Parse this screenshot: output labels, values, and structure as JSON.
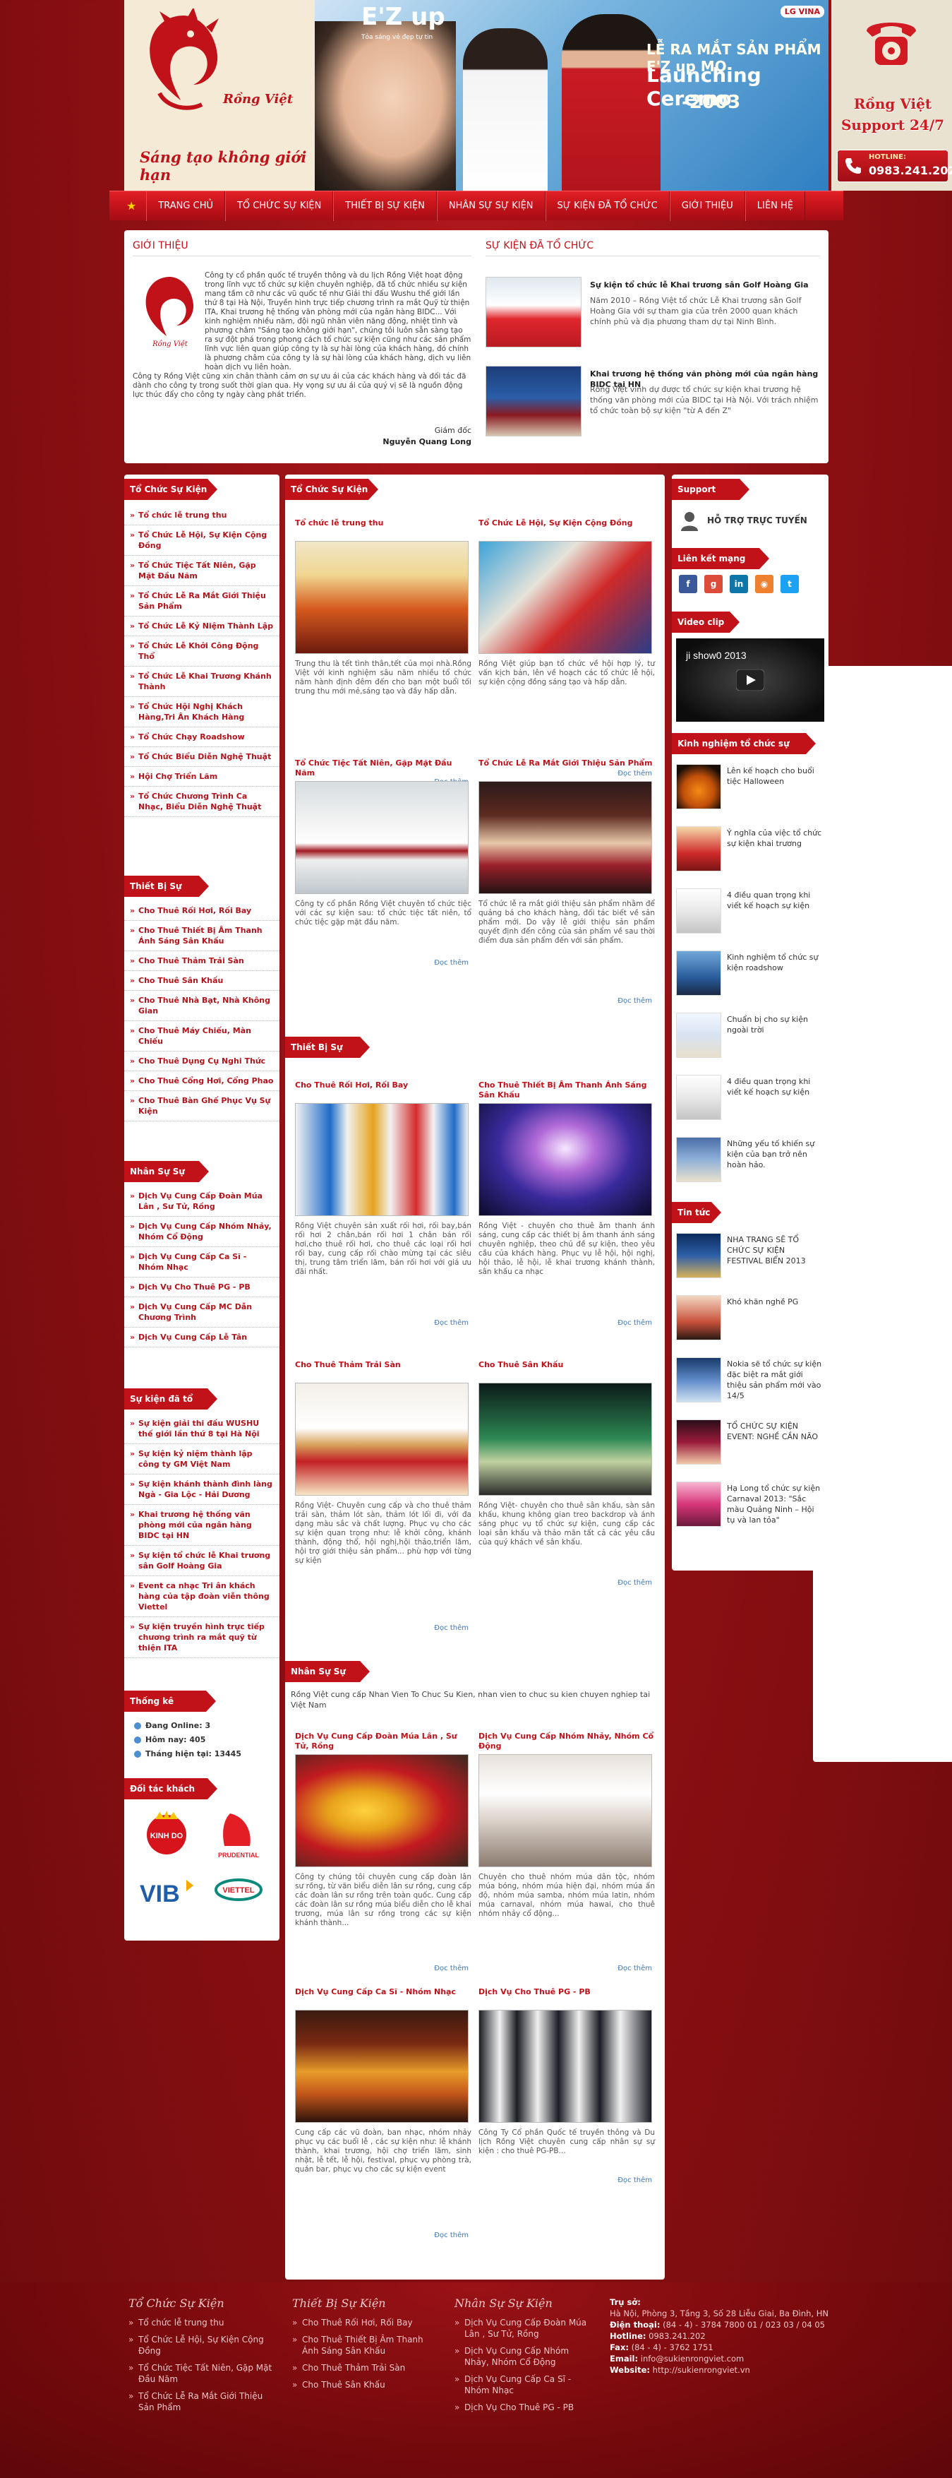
{
  "brand": {
    "name": "Rồng Việt",
    "slogan": "Sáng tạo không giới hạn"
  },
  "banner": {
    "product": "E'Z up",
    "tagline": "Tỏa sáng vẻ đẹp tự tin",
    "headline_small": "LỄ RA MẮT SẢN PHẨM E'Z up MO",
    "headline": "Launching Ceremo",
    "year": "-2003",
    "lg": "LG VINA"
  },
  "support": {
    "title": "Rồng Việt Support 24/7",
    "hotline_label": "HOTLINE:",
    "hotline_number": "0983.241.202"
  },
  "nav": {
    "items": [
      "TRANG CHỦ",
      "TỔ CHỨC SỰ KIỆN",
      "THIẾT BỊ SỰ KIỆN",
      "NHÂN SỰ SỰ KIỆN",
      "SỰ KIỆN ĐÃ TỔ CHỨC",
      "GIỚI THIỆU",
      "LIÊN HỆ"
    ]
  },
  "intro": {
    "title": "GIỚI THIỆU",
    "paragraphs": [
      "Công ty cổ phần quốc tế truyền thông và du lịch Rồng Việt hoạt động trong lĩnh vực tổ chức sự kiện chuyên nghiệp, đã tổ chức nhiều sự kiện mang tầm cỡ như các vũ quốc tế như Giải thi đấu Wushu thế giới lần thứ 8 tại Hà Nội, Truyền hình trực tiếp chương trình ra mắt Quỹ từ thiện ITA, Khai trương hệ thống văn phòng mới của ngân hàng BIDC... Với kinh nghiệm nhiều năm, đội ngũ nhân viên năng động, nhiệt tình và phương châm \"Sáng tạo không giới hạn\", chúng tôi luôn sẵn sàng tạo ra sự đột phá trong phong cách tổ chức sự kiện cũng như các sản phẩm lĩnh vực liên quan giúp công ty là sự hài lòng của khách hàng, đó chính là phương châm của công ty là sự hài lòng của khách hàng, dịch vụ liên hoàn dịch vụ liên hoàn.",
      "Công ty Rồng Việt cũng xin chân thành cảm ơn sự ưu ái của các khách hàng và đối tác đã dành cho công ty trong suốt thời gian qua. Hy vọng sự ưu ái của quý vị sẽ là nguồn động lực thúc đẩy cho công ty ngày càng phát triển."
    ],
    "sign_role": "Giám đốc",
    "sign_name": "Nguyễn Quang Long"
  },
  "organized": {
    "title": "SỰ KIỆN ĐÃ TỔ CHỨC",
    "items": [
      {
        "title": "Sự kiện tổ chức lễ Khai trương sân Golf Hoàng Gia",
        "desc": "Năm 2010 – Rồng Việt tổ chức Lễ Khai trương sân Golf Hoàng Gia với sự tham gia của trên 2000 quan khách chính phủ và địa phương tham dự tại Ninh Bình."
      },
      {
        "title": "Khai trương hệ thống văn phòng mới của ngân hàng BIDC tại HN",
        "desc": "Rồng Việt vinh dự được tổ chức sự kiện khai trương hệ thống văn phòng mới của BIDC tại Hà Nội. Với trách nhiệm tổ chức toàn bộ sự kiện \"từ A đến Z\""
      }
    ]
  },
  "left": {
    "sec1_title": "Tổ Chức Sự Kiện",
    "sec1_items": [
      "Tổ chức lễ trung thu",
      "Tổ Chức Lễ Hội, Sự Kiện Cộng Đồng",
      "Tổ Chức Tiệc Tất Niên, Gặp Mặt Đầu Năm",
      "Tổ Chức Lễ Ra Mắt Giới Thiệu Sản Phẩm",
      "Tổ Chức Lễ Kỷ Niệm Thành Lập",
      "Tổ Chức Lễ Khởi Công Động Thổ",
      "Tổ Chức Lễ Khai Trương Khánh Thành",
      "Tổ Chức Hội Nghị Khách Hàng,Tri Ân Khách Hàng",
      "Tổ Chức Chạy Roadshow",
      "Tổ Chức Biểu Diễn Nghệ Thuật",
      "Hội Chợ Triển Lãm",
      "Tổ Chức Chương Trình Ca Nhạc, Biểu Diễn Nghệ Thuật"
    ],
    "sec2_title": "Thiết Bị Sự Kiện",
    "sec2_items": [
      "Cho Thuê Rối Hơi, Rối Bay",
      "Cho Thuê Thiết Bị Âm Thanh Ánh Sáng Sân Khấu",
      "Cho Thuê Thảm Trải Sàn",
      "Cho Thuê Sân Khấu",
      "Cho Thuê Nhà Bạt, Nhà Không Gian",
      "Cho Thuê Máy Chiếu, Màn Chiếu",
      "Cho Thuê Dụng Cụ Nghi Thức",
      "Cho Thuê Cổng Hơi, Cổng Phao",
      "Cho Thuê Bàn Ghế Phục Vụ Sự Kiện"
    ],
    "sec3_title": "Nhân Sự Sự Kiện",
    "sec3_items": [
      "Dịch Vụ Cung Cấp Đoàn Múa Lân , Sư Tử, Rồng",
      "Dịch Vụ Cung Cấp Nhóm Nhảy, Nhóm Cổ Động",
      "Dịch Vụ Cung Cấp Ca Sĩ - Nhóm Nhạc",
      "Dịch Vụ Cho Thuê PG - PB",
      "Dịch Vụ Cung Cấp MC Dẫn Chương Trình",
      "Dịch Vụ Cung Cấp Lễ Tân"
    ],
    "sec4_title": "Sự kiện đã tổ chức",
    "sec4_items": [
      "Sự kiện giải thi đấu WUSHU thế giới lần thứ 8 tại Hà Nội",
      "Sự kiện kỷ niệm thành lập công ty GM Việt Nam",
      "Sự kiện khánh thành đình làng Ngà - Gia Lộc - Hải Dương",
      "Khai trương hệ thống văn phòng mới của ngân hàng BIDC tại HN",
      "Sự kiện tổ chức lễ Khai trương sân Golf Hoàng Gia",
      "Event ca nhạc Tri ân khách hàng của tập đoàn viễn thông Viettel",
      "Sự kiện truyền hình trực tiếp chương trình ra mắt quỹ từ thiện ITA"
    ],
    "stats_title": "Thống kê website",
    "stats": [
      {
        "label": "Đang Online:",
        "value": "3"
      },
      {
        "label": "Hôm nay:",
        "value": "405"
      },
      {
        "label": "Tháng hiện tại:",
        "value": "13445"
      }
    ],
    "partners_title": "Đối tác khách hàng",
    "partners": [
      "KINH DO",
      "PRUDENTIAL",
      "VIB",
      "VIETTEL"
    ]
  },
  "center": {
    "sec1_title": "Tổ Chức Sự Kiện",
    "sec1_cards": [
      {
        "title": "Tổ chức lễ trung thu",
        "desc": "Trung thu là tết tình thân,tết của mọi nhà.Rồng Việt với kinh nghiệm sâu năm nhiều tổ chức năm hành định đêm đến cho bạn một buổi tối trung thu mới mẻ,sáng tạo và đầy hấp dẫn.",
        "more": "Đọc thêm"
      },
      {
        "title": "Tổ Chức Lễ Hội, Sự Kiện Cộng Đồng",
        "desc": "Rồng Việt giúp bạn tổ chức về hội hợp lý, tư vấn kịch bản, lên về hoạch các tổ chức lễ hội, sự kiện cộng đồng sáng tạo và hấp dẫn.",
        "more": "Đọc thêm"
      },
      {
        "title": "Tổ Chức Tiệc Tất Niên, Gặp Mặt Đầu Năm",
        "desc": "Công ty cổ phần Rồng Việt chuyên tổ chức tiệc với các sự kiện sau: tổ chức tiệc tất niên, tổ chức tiệc gặp mặt đầu năm.",
        "more": "Đọc thêm"
      },
      {
        "title": "Tổ Chức Lễ Ra Mắt Giới Thiệu Sản Phẩm",
        "desc": "Tổ chức lễ ra mắt giới thiệu sản phẩm nhằm để quảng bá cho khách hàng, đối tác biết về sản phẩm mới. Do vậy lễ giới thiệu sản phẩm quyết định đến công của sản phẩm về sau thời điểm đưa sản phẩm đến với sản phẩm.",
        "more": "Đọc thêm"
      }
    ],
    "sec2_title": "Thiết Bị Sự Kiện",
    "sec2_cards": [
      {
        "title": "Cho Thuê Rối Hơi, Rối Bay",
        "desc": "Rồng Việt chuyên sản xuất rối hơi, rối bay,bán rối hơi 2 chân,bán rối hơi 1 chân bán rối hơi,cho thuê rối hơi, cho thuê các loại rối hơi rối bay, cung cấp rối chào mừng tại các siêu thị, trung tâm triển lãm, bán rối hơi với giá ưu đãi nhất.",
        "more": "Đọc thêm"
      },
      {
        "title": "Cho Thuê Thiết Bị Âm Thanh Ánh Sáng Sân Khấu",
        "desc": "Rồng Việt - chuyên cho thuê âm thanh ánh sáng, cung cấp các thiết bị âm thanh ánh sáng chuyên nghiệp, theo chủ đề sự kiện, theo yêu cầu của khách hàng. Phục vụ lễ hội, hội nghị, hội thảo, lễ hội, lễ khai trương khánh thành, sân khấu ca nhạc",
        "more": "Đọc thêm"
      },
      {
        "title": "Cho Thuê Thảm Trải Sàn",
        "desc": "Rồng Việt- Chuyên cung cấp và cho thuê thảm trải sàn, thảm lót sàn, thảm lót lối đi, với đa dạng màu sắc và chất lượng. Phục vụ cho các sự kiện quan trọng như: lễ khởi công, khánh thành, động thổ, hội nghị,hội thảo,triển lãm, hội trợ giới thiệu sản phẩm... phù hợp với từng sự kiện",
        "more": "Đọc thêm"
      },
      {
        "title": "Cho Thuê Sân Khấu",
        "desc": "Rồng Việt- chuyên cho thuê sân khấu, sàn sân khấu, khung không gian treo backdrop và ánh sáng phục vụ tổ chức sự kiện, cung cấp các loại sân khấu và thảo mãn tất cả các yêu cầu của quý khách về sân khấu.",
        "more": "Đọc thêm"
      }
    ],
    "sec3_title": "Nhân Sự Sự Kiện",
    "sec3_intro": "Rồng Việt cung cấp Nhan Vien To Chuc Su Kien, nhan vien to chuc su kien chuyen nghiep tai Việt Nam",
    "sec3_cards": [
      {
        "title": "Dịch Vụ Cung Cấp Đoàn Múa Lân , Sư Tử, Rồng",
        "desc": "Công ty chúng tôi chuyên cung cấp đoàn lân sư rồng, từ văn biểu diễn lân sư rồng, cung cấp các đoàn lân sư rồng trên toàn quốc. Cung cấp các đoàn lân sư rồng múa biểu diễn cho lễ khai trương, múa lân sư rồng trong các sự kiện khánh thành...",
        "more": "Đọc thêm"
      },
      {
        "title": "Dịch Vụ Cung Cấp Nhóm Nhảy, Nhóm Cổ Động",
        "desc": "Chuyên cho thuê nhóm múa dân tộc, nhóm múa bóng, nhóm múa hiện đại, nhóm múa ấn độ, nhóm múa samba, nhóm múa latin, nhóm múa carnaval, nhóm múa hawai, cho thuê nhóm nhảy cổ động...",
        "more": "Đọc thêm"
      },
      {
        "title": "Dịch Vụ Cung Cấp Ca Sĩ - Nhóm Nhạc",
        "desc": "Cung cấp các vũ đoàn, ban nhạc, nhóm nhảy phục vụ các buổi lễ , các sự kiện như: lễ khánh thành, khai trương, hội chợ triển lãm, sinh nhật, lễ tết, lễ hội, festival, phục vụ phòng trà, quán bar, phục vụ cho các sự kiện event",
        "more": "Đọc thêm"
      },
      {
        "title": "Dịch Vụ Cho Thuê PG - PB",
        "desc": "Công Ty Cổ phần Quốc tế truyền thông và Du lịch Rồng Việt chuyên cung cấp nhân sự sự kiện : cho thuê PG-PB...",
        "more": "Đọc thêm"
      }
    ]
  },
  "right": {
    "online_title": "Support Online",
    "online_label": "HỖ TRỢ TRỰC TUYẾN",
    "social_title": "Liên kết mạng xã hội",
    "video_title": "Video clip",
    "video_caption": "ji show0 2013",
    "kn_title": "Kinh nghiệm tổ chức sự kiện",
    "kn_items": [
      "Lên kế hoạch cho buổi tiệc Halloween",
      "Ý nghĩa của việc tổ chức sự kiện khai trương",
      "4 điều quan trọng khi viết kế hoạch sự kiện",
      "Kinh nghiệm tổ chức sự kiện roadshow",
      "Chuẩn bị cho sự kiện ngoài trời",
      "4 điều quan trọng khi viết kế hoạch sự kiện",
      "Những yếu tố khiến sự kiện của bạn trở nên hoàn hảo."
    ],
    "news_title": "Tin tức",
    "news_items": [
      "NHA TRANG SẼ TỔ CHỨC SỰ KIỆN FESTIVAL BIỂN 2013",
      "Khó khăn nghề PG",
      "Nokia sẽ tổ chức sự kiện đặc biệt ra mắt giới thiệu sản phẩm mới vào 14/5",
      "TỔ CHỨC SỰ KIỆN EVENT: NGHỀ CẦN NÃO",
      "Hạ Long tổ chức sự kiện Carnaval 2013: \"Sắc màu Quảng Ninh – Hội tụ và lan tỏa\""
    ]
  },
  "footer": {
    "col1_title": "Tổ Chức Sự Kiện",
    "col1_items": [
      "Tổ chức lễ trung thu",
      "Tổ Chức Lễ Hội, Sự Kiện Cộng Đồng",
      "Tổ Chức Tiệc Tất Niên, Gặp Mặt Đầu Năm",
      "Tổ Chức Lễ Ra Mắt Giới Thiệu Sản Phẩm"
    ],
    "col2_title": "Thiết Bị Sự Kiện",
    "col2_items": [
      "Cho Thuê Rối Hơi, Rối Bay",
      "Cho Thuê Thiết Bị Âm Thanh Ánh Sáng Sân Khấu",
      "Cho Thuê Thảm Trải Sàn",
      "Cho Thuê Sân Khấu"
    ],
    "col3_title": "Nhân Sự Sự Kiện",
    "col3_items": [
      "Dịch Vụ Cung Cấp Đoàn Múa Lân , Sư Tử, Rồng",
      "Dịch Vụ Cung Cấp Nhóm Nhảy, Nhóm Cổ Động",
      "Dịch Vụ Cung Cấp Ca Sĩ - Nhóm Nhạc",
      "Dịch Vụ Cho Thuê PG - PB"
    ],
    "contact": {
      "head": "Trụ sở:",
      "address": "Hà Nội, Phòng 3, Tầng 3, Số 28 Liễu Giai, Ba Đình, HN",
      "phone_label": "Điện thoại:",
      "phone": "(84 - 4) - 3784 7800 01 / 023 03 / 04 05",
      "hotline_label": "Hotline:",
      "hotline": "0983.241.202",
      "fax_label": "Fax:",
      "fax": "(84 - 4) - 3762 1751",
      "email_label": "Email:",
      "email": "info@sukienrongviet.com",
      "web_label": "Website:",
      "web": "http://sukienrongviet.vn"
    }
  },
  "colors": {
    "accent": "#c1121a",
    "background": "#8f1014",
    "link": "#3a78b8"
  }
}
